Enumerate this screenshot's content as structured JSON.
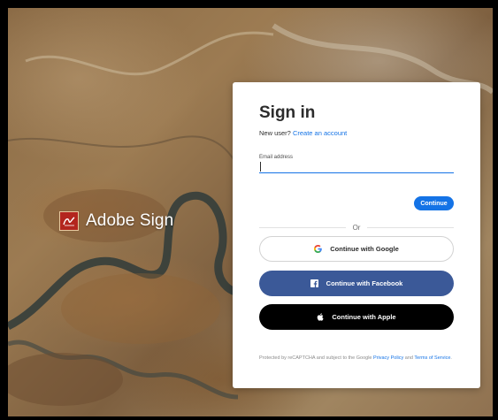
{
  "brand": {
    "logo_icon": "adobe-sign-logo-icon",
    "name": "Adobe Sign"
  },
  "signin": {
    "title": "Sign in",
    "new_user_text": "New user?",
    "create_account_link": "Create an account",
    "email_label": "Email address",
    "email_value": "",
    "continue_label": "Continue",
    "or_text": "Or"
  },
  "social": {
    "google_label": "Continue with Google",
    "google_icon": "google-icon",
    "facebook_label": "Continue with Facebook",
    "facebook_icon": "facebook-icon",
    "apple_label": "Continue with Apple",
    "apple_icon": "apple-icon"
  },
  "recaptcha": {
    "prefix": "Protected by reCAPTCHA and subject to the Google",
    "privacy_link": "Privacy Policy",
    "and_text": "and",
    "terms_link": "Terms of Service",
    "suffix": "."
  },
  "colors": {
    "accent": "#1473e6",
    "facebook": "#3b5998",
    "apple": "#000000",
    "brand_red": "#b3261e"
  }
}
